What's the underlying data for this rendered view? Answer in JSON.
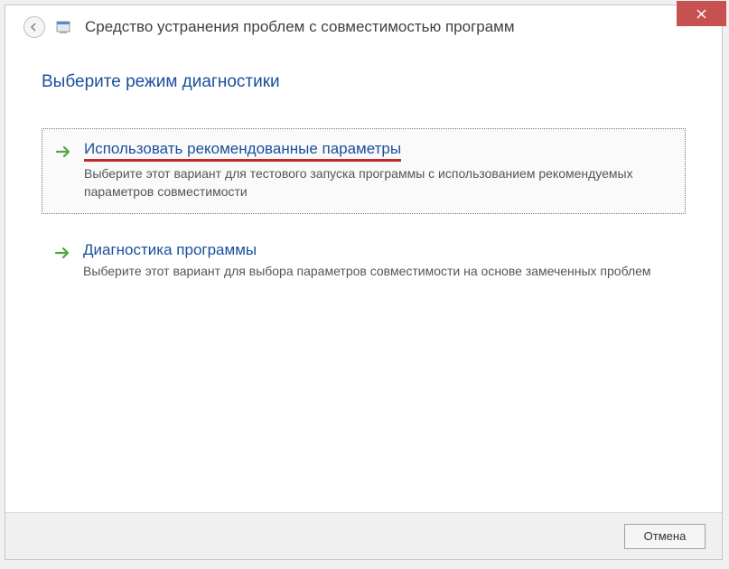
{
  "window": {
    "title": "Средство устранения проблем с совместимостью программ"
  },
  "content": {
    "heading": "Выберите режим диагностики"
  },
  "options": [
    {
      "title": "Использовать рекомендованные параметры",
      "description": "Выберите этот вариант для тестового запуска программы с использованием рекомендуемых параметров совместимости"
    },
    {
      "title": "Диагностика программы",
      "description": "Выберите этот вариант для выбора параметров совместимости на основе замеченных проблем"
    }
  ],
  "footer": {
    "cancel_label": "Отмена"
  }
}
